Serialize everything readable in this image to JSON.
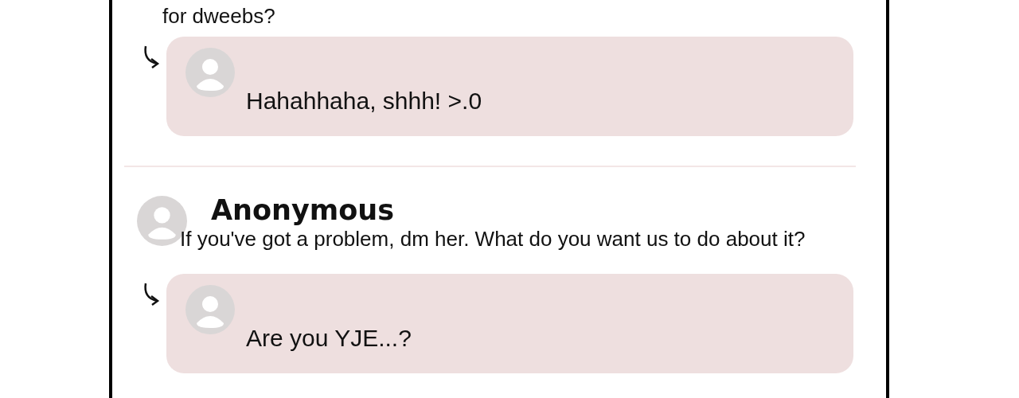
{
  "thread": [
    {
      "kind": "tail",
      "text": "for dweebs?",
      "reply": {
        "text": "Hahahhaha, shhh! >.0"
      }
    },
    {
      "kind": "comment",
      "author": "Anonymous",
      "text": "If you've got a problem, dm her. What do you want us to do about it?",
      "reply": {
        "text": "Are you YJE...?"
      }
    }
  ]
}
